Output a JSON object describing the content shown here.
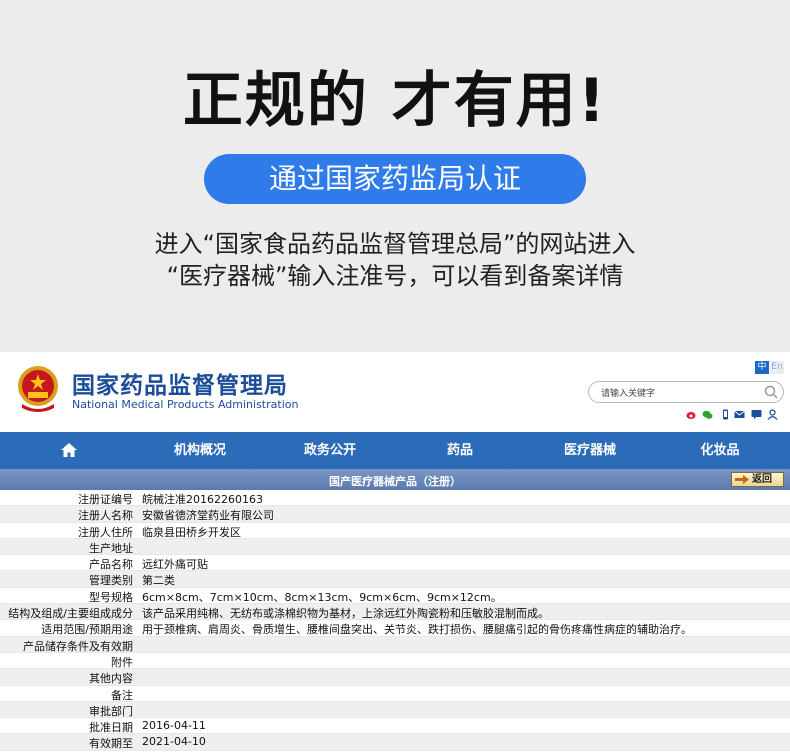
{
  "promo": {
    "headline": "正规的 才有用!",
    "pill_text": "通过国家药监局认证",
    "line1": "进入“国家食品药品监督管理总局”的网站进入",
    "line2": "“医疗器械”输入注准号，可以看到备案详情"
  },
  "site": {
    "name_cn": "国家药品监督管理局",
    "name_en": "National Medical Products Administration",
    "lang_cn": "中",
    "lang_en": "En",
    "search_placeholder": "请输入关键字",
    "social_icons": [
      "weibo-icon",
      "wechat-icon",
      "mobile-icon",
      "mail-icon",
      "message-icon",
      "user-icon"
    ],
    "nav": [
      {
        "label": ""
      },
      {
        "label": "机构概况"
      },
      {
        "label": "政务公开"
      },
      {
        "label": "药品"
      },
      {
        "label": "医疗器械"
      },
      {
        "label": "化妆品"
      }
    ],
    "section_title": "国产医疗器械产品（注册）",
    "back_label": "返回",
    "colors": {
      "nav": "#2c6bb8",
      "brand": "#1c4d9a",
      "accent": "#2f7bea"
    }
  },
  "rows": [
    {
      "label": "注册证编号",
      "value": "皖械注准20162260163"
    },
    {
      "label": "注册人名称",
      "value": "安徽省德济堂药业有限公司"
    },
    {
      "label": "注册人住所",
      "value": "临泉县田桥乡开发区"
    },
    {
      "label": "生产地址",
      "value": ""
    },
    {
      "label": "产品名称",
      "value": "远红外痛可贴"
    },
    {
      "label": "管理类别",
      "value": "第二类"
    },
    {
      "label": "型号规格",
      "value": "6cm×8cm、7cm×10cm、8cm×13cm、9cm×6cm、9cm×12cm。"
    },
    {
      "label": "结构及组成/主要组成成分",
      "value": "该产品采用纯棉、无纺布或涤棉织物为基材，上涂远红外陶瓷粉和压敏胶混制而成。"
    },
    {
      "label": "适用范围/预期用途",
      "value": "用于颈椎病、肩周炎、骨质增生、腰椎间盘突出、关节炎、跌打损伤、腰腿痛引起的骨伤疼痛性病症的辅助治疗。"
    },
    {
      "label": "产品储存条件及有效期",
      "value": ""
    },
    {
      "label": "附件",
      "value": ""
    },
    {
      "label": "其他内容",
      "value": ""
    },
    {
      "label": "备注",
      "value": ""
    },
    {
      "label": "审批部门",
      "value": ""
    },
    {
      "label": "批准日期",
      "value": "2016-04-11"
    },
    {
      "label": "有效期至",
      "value": "2021-04-10"
    }
  ]
}
